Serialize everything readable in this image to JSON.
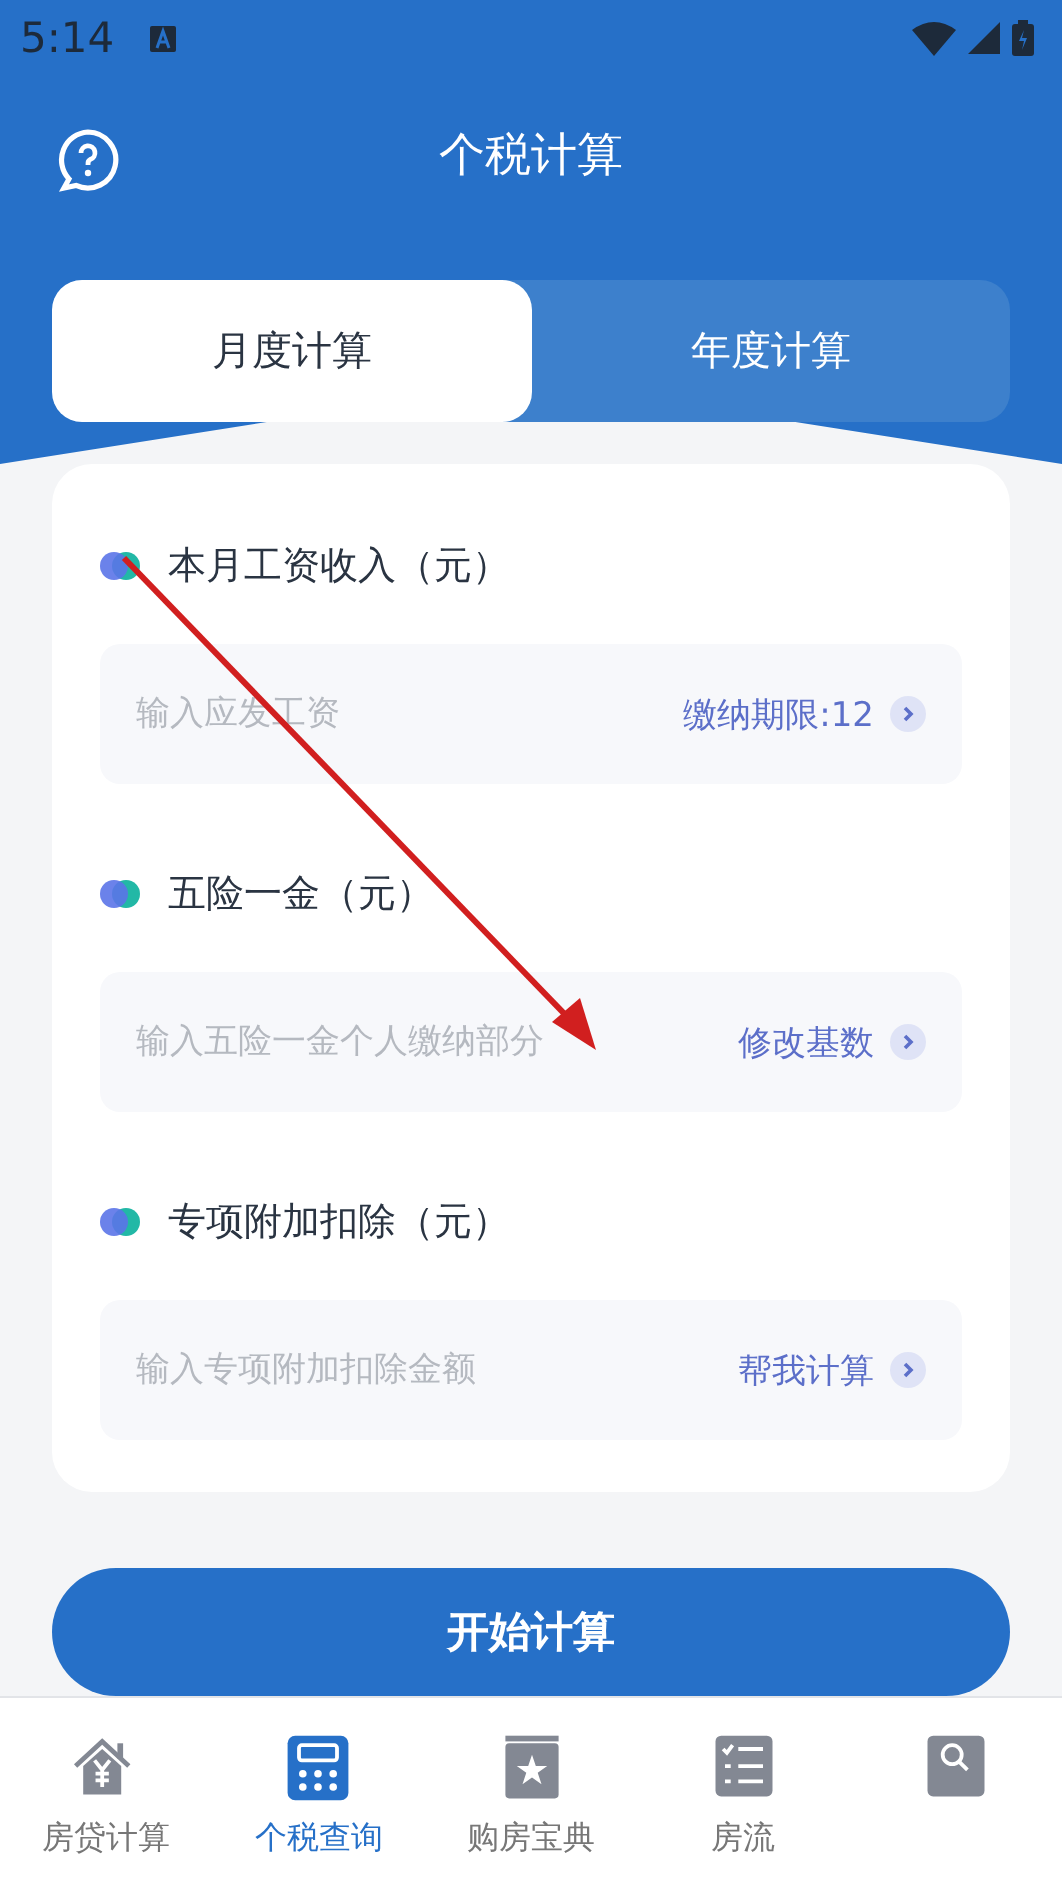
{
  "status_bar": {
    "time": "5:14"
  },
  "header": {
    "title": "个税计算"
  },
  "tabs": [
    {
      "label": "月度计算",
      "selected": true
    },
    {
      "label": "年度计算",
      "selected": false
    }
  ],
  "fields": [
    {
      "label": "本月工资收入（元）",
      "placeholder": "输入应发工资",
      "action": "缴纳期限:12"
    },
    {
      "label": "五险一金（元）",
      "placeholder": "输入五险一金个人缴纳部分",
      "action": "修改基数"
    },
    {
      "label": "专项附加扣除（元）",
      "placeholder": "输入专项附加扣除金额",
      "action": "帮我计算"
    }
  ],
  "submit_button": "开始计算",
  "nav": [
    {
      "label": "房贷计算",
      "kind": "house",
      "selected": false
    },
    {
      "label": "个税查询",
      "kind": "calculator",
      "selected": true
    },
    {
      "label": "购房宝典",
      "kind": "book",
      "selected": false
    },
    {
      "label": "房流",
      "kind": "checklist",
      "selected": false
    },
    {
      "kind": "search",
      "selected": false
    }
  ]
}
